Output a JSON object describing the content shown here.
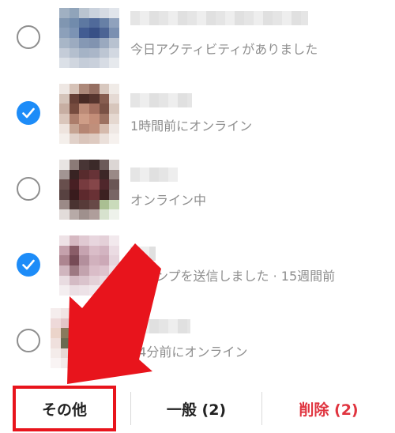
{
  "rows": [
    {
      "selected": false,
      "status": "今日アクティビティがありました"
    },
    {
      "selected": true,
      "status": "1時間前にオンライン"
    },
    {
      "selected": false,
      "status": "オンライン中"
    },
    {
      "selected": true,
      "status": "スタンプを送信しました · 15週間前"
    },
    {
      "selected": false,
      "status": "24分前にオンライン"
    }
  ],
  "actions": {
    "other_label": "その他",
    "general_label": "一般 (2)",
    "delete_label": "削除 (2)"
  },
  "colors": {
    "checked": "#1d8cf8",
    "delete": "#e0343f",
    "highlight": "#e8141c"
  }
}
